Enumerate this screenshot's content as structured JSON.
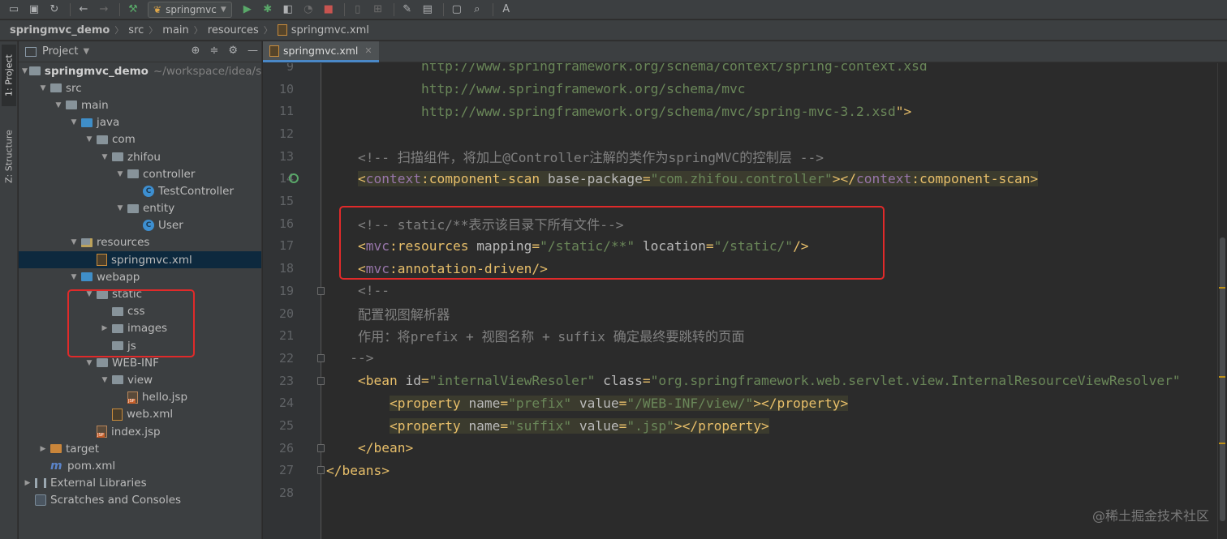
{
  "toolbar": {
    "run_config": "springmvc"
  },
  "breadcrumb": [
    "springmvc_demo",
    "src",
    "main",
    "resources",
    "springmvc.xml"
  ],
  "side_tabs": {
    "project": "1: Project",
    "structure": "Z: Structure"
  },
  "project_panel": {
    "title": "Project",
    "root_path": "~/workspace/idea/sp"
  },
  "tree": [
    {
      "label": "springmvc_demo",
      "indent": 0,
      "arrow": "down",
      "icon": "folder",
      "bold": true
    },
    {
      "label": "src",
      "indent": 1,
      "arrow": "down",
      "icon": "folder"
    },
    {
      "label": "main",
      "indent": 2,
      "arrow": "down",
      "icon": "folder"
    },
    {
      "label": "java",
      "indent": 3,
      "arrow": "down",
      "icon": "folder-blue"
    },
    {
      "label": "com",
      "indent": 4,
      "arrow": "down",
      "icon": "folder"
    },
    {
      "label": "zhifou",
      "indent": 5,
      "arrow": "down",
      "icon": "folder"
    },
    {
      "label": "controller",
      "indent": 6,
      "arrow": "down",
      "icon": "folder"
    },
    {
      "label": "TestController",
      "indent": 7,
      "arrow": "none",
      "icon": "class"
    },
    {
      "label": "entity",
      "indent": 6,
      "arrow": "down",
      "icon": "folder"
    },
    {
      "label": "User",
      "indent": 7,
      "arrow": "none",
      "icon": "class"
    },
    {
      "label": "resources",
      "indent": 3,
      "arrow": "down",
      "icon": "folder-res"
    },
    {
      "label": "springmvc.xml",
      "indent": 4,
      "arrow": "none",
      "icon": "xml",
      "selected": true
    },
    {
      "label": "webapp",
      "indent": 3,
      "arrow": "down",
      "icon": "folder-blue"
    },
    {
      "label": "static",
      "indent": 4,
      "arrow": "down",
      "icon": "folder"
    },
    {
      "label": "css",
      "indent": 5,
      "arrow": "none",
      "icon": "folder"
    },
    {
      "label": "images",
      "indent": 5,
      "arrow": "right",
      "icon": "folder"
    },
    {
      "label": "js",
      "indent": 5,
      "arrow": "none",
      "icon": "folder"
    },
    {
      "label": "WEB-INF",
      "indent": 4,
      "arrow": "down",
      "icon": "folder"
    },
    {
      "label": "view",
      "indent": 5,
      "arrow": "down",
      "icon": "folder"
    },
    {
      "label": "hello.jsp",
      "indent": 6,
      "arrow": "none",
      "icon": "jsp"
    },
    {
      "label": "web.xml",
      "indent": 5,
      "arrow": "none",
      "icon": "xml"
    },
    {
      "label": "index.jsp",
      "indent": 4,
      "arrow": "none",
      "icon": "jsp"
    },
    {
      "label": "target",
      "indent": 1,
      "arrow": "right",
      "icon": "folder-orange"
    },
    {
      "label": "pom.xml",
      "indent": 1,
      "arrow": "none",
      "icon": "maven"
    },
    {
      "label": "External Libraries",
      "indent": 0,
      "arrow": "right",
      "icon": "library"
    },
    {
      "label": "Scratches and Consoles",
      "indent": 0,
      "arrow": "none",
      "icon": "scratch"
    }
  ],
  "editor": {
    "tab_label": "springmvc.xml",
    "lines": [
      {
        "n": "9",
        "tokens": [
          [
            "c-url",
            "            http://www.springframework.org/schema/context/spring-context.xsd"
          ]
        ]
      },
      {
        "n": "10",
        "tokens": [
          [
            "c-url",
            "            http://www.springframework.org/schema/mvc"
          ]
        ]
      },
      {
        "n": "11",
        "tokens": [
          [
            "c-url",
            "            http://www.springframework.org/schema/mvc/spring-mvc-3.2.xsd"
          ],
          [
            "c-tag",
            "\">"
          ]
        ]
      },
      {
        "n": "12",
        "tokens": []
      },
      {
        "n": "13",
        "tokens": [
          [
            "c-comment",
            "    <!-- 扫描组件，将加上@Controller注解的类作为springMVC的控制层 -->"
          ]
        ]
      },
      {
        "n": "14",
        "tokens": [
          [
            "c-tag",
            "    <"
          ],
          [
            "c-ns",
            "context"
          ],
          [
            "c-tag",
            ":component-scan "
          ],
          [
            "c-attr",
            "base-package"
          ],
          [
            "c-tag",
            "="
          ],
          [
            "c-val",
            "\"com.zhifou.controller\""
          ],
          [
            "c-tag",
            "></"
          ],
          [
            "c-ns",
            "context"
          ],
          [
            "c-tag",
            ":component-scan>"
          ]
        ]
      },
      {
        "n": "15",
        "tokens": []
      },
      {
        "n": "16",
        "tokens": [
          [
            "c-comment",
            "    <!-- static/**表示该目录下所有文件-->"
          ]
        ]
      },
      {
        "n": "17",
        "tokens": [
          [
            "c-tag",
            "    <"
          ],
          [
            "c-ns",
            "mvc"
          ],
          [
            "c-tag",
            ":resources "
          ],
          [
            "c-attr",
            "mapping"
          ],
          [
            "c-tag",
            "="
          ],
          [
            "c-val",
            "\"/static/**\" "
          ],
          [
            "c-attr",
            "location"
          ],
          [
            "c-tag",
            "="
          ],
          [
            "c-val",
            "\"/static/\""
          ],
          [
            "c-tag",
            "/>"
          ]
        ]
      },
      {
        "n": "18",
        "tokens": [
          [
            "c-tag",
            "    <"
          ],
          [
            "c-ns",
            "mvc"
          ],
          [
            "c-tag",
            ":annotation-driven/>"
          ]
        ]
      },
      {
        "n": "19",
        "tokens": [
          [
            "c-comment",
            "    <!--"
          ]
        ]
      },
      {
        "n": "20",
        "tokens": [
          [
            "c-comment",
            "    配置视图解析器"
          ]
        ]
      },
      {
        "n": "21",
        "tokens": [
          [
            "c-comment",
            "    作用：将prefix + 视图名称 + suffix 确定最终要跳转的页面"
          ]
        ]
      },
      {
        "n": "22",
        "tokens": [
          [
            "c-comment",
            "   -->"
          ]
        ]
      },
      {
        "n": "23",
        "tokens": [
          [
            "c-tag",
            "    <bean "
          ],
          [
            "c-attr",
            "id"
          ],
          [
            "c-tag",
            "="
          ],
          [
            "c-val",
            "\"internalViewResoler\" "
          ],
          [
            "c-attr",
            "class"
          ],
          [
            "c-tag",
            "="
          ],
          [
            "c-val",
            "\"org.springframework.web.servlet.view.InternalResourceViewResolver\""
          ]
        ]
      },
      {
        "n": "24",
        "tokens": [
          [
            "c-tag",
            "        <property "
          ],
          [
            "c-attr",
            "name"
          ],
          [
            "c-tag",
            "="
          ],
          [
            "c-val",
            "\"prefix\" "
          ],
          [
            "c-attr",
            "value"
          ],
          [
            "c-tag",
            "="
          ],
          [
            "c-val",
            "\"/WEB-INF/view/\""
          ],
          [
            "c-tag",
            "></property>"
          ]
        ]
      },
      {
        "n": "25",
        "tokens": [
          [
            "c-tag",
            "        <property "
          ],
          [
            "c-attr",
            "name"
          ],
          [
            "c-tag",
            "="
          ],
          [
            "c-val",
            "\"suffix\" "
          ],
          [
            "c-attr",
            "value"
          ],
          [
            "c-tag",
            "="
          ],
          [
            "c-val",
            "\".jsp\""
          ],
          [
            "c-tag",
            "></property>"
          ]
        ]
      },
      {
        "n": "26",
        "tokens": [
          [
            "c-tag",
            "    </bean>"
          ]
        ]
      },
      {
        "n": "27",
        "tokens": [
          [
            "c-tag",
            "</beans>"
          ]
        ]
      },
      {
        "n": "28",
        "tokens": []
      }
    ]
  },
  "watermark": "@稀土掘金技术社区",
  "colors": {
    "highlight_box": "#e02a2a",
    "selection": "#0d293e",
    "accent_tab": "#4a88c7"
  }
}
